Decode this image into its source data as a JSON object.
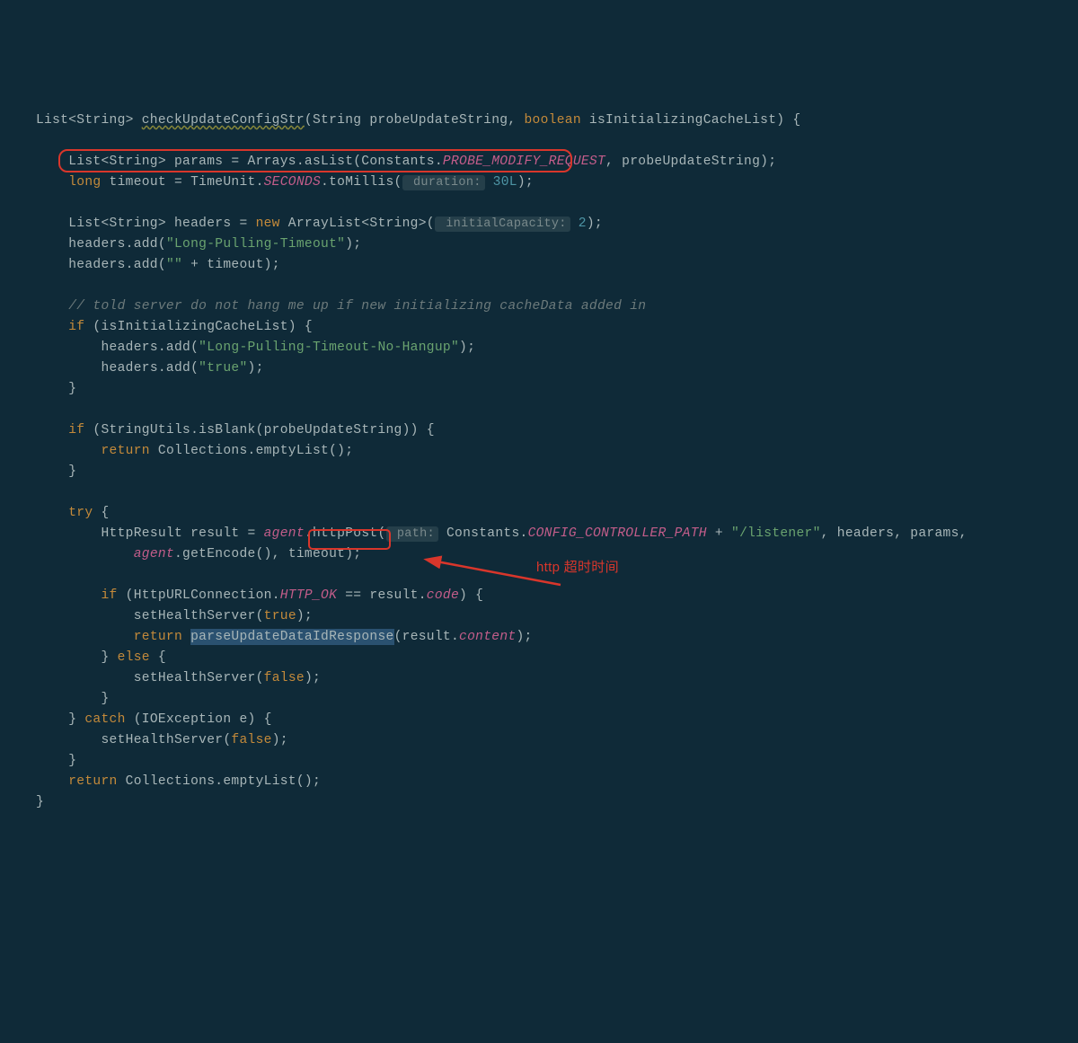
{
  "code": {
    "l1": {
      "a": "List<String> ",
      "b": "checkUpdateConfigStr",
      "c": "(String probeUpdateString, ",
      "d": "boolean",
      "e": " isInitializingCacheList) {"
    },
    "l3": {
      "a": "List<String> params = Arrays.asList(Constants.",
      "b": "PROBE_MODIFY_REQUEST",
      "c": ", probeUpdateString);"
    },
    "l4": {
      "a": "long",
      "b": " timeout = TimeUnit.",
      "c": "SECONDS",
      "d": ".toMillis(",
      "hint": " duration:",
      "e": " 30L",
      "f": ");"
    },
    "l6": {
      "a": "List<String> headers = ",
      "b": "new",
      "c": " ArrayList<String>(",
      "hint": " initialCapacity:",
      "d": " 2",
      "e": ");"
    },
    "l7": {
      "a": "headers.add(",
      "b": "\"Long-Pulling-Timeout\"",
      "c": ");"
    },
    "l8": {
      "a": "headers.add(",
      "b": "\"\"",
      "c": " + timeout);"
    },
    "l10": {
      "a": "// told server do not hang me up if new initializing cacheData added in"
    },
    "l11": {
      "a": "if",
      "b": " (isInitializingCacheList) {"
    },
    "l12": {
      "a": "headers.add(",
      "b": "\"Long-Pulling-Timeout-No-Hangup\"",
      "c": ");"
    },
    "l13": {
      "a": "headers.add(",
      "b": "\"true\"",
      "c": ");"
    },
    "l14": {
      "a": "}"
    },
    "l16": {
      "a": "if",
      "b": " (StringUtils.isBlank(probeUpdateString)) {"
    },
    "l17": {
      "a": "return",
      "b": " Collections.emptyList();"
    },
    "l18": {
      "a": "}"
    },
    "l20": {
      "a": "try",
      "b": " {"
    },
    "l21": {
      "a": "HttpResult result = ",
      "b": "agent",
      "c": ".httpPost(",
      "hint": " path:",
      "d": " Constants.",
      "e": "CONFIG_CONTROLLER_PATH",
      "f": " + ",
      "g": "\"/listener\"",
      "h": ", headers, params,"
    },
    "l22": {
      "a": "agent",
      "b": ".getEncode(), ",
      "c": "timeout",
      "d": ");"
    },
    "l24": {
      "a": "if",
      "b": " (HttpURLConnection.",
      "c": "HTTP_OK",
      "d": " == result.",
      "e": "code",
      "f": ") {"
    },
    "l25": {
      "a": "setHealthServer(",
      "b": "true",
      "c": ");"
    },
    "l26": {
      "a": "return",
      "b": " ",
      "c": "parseUpdateDataIdResponse",
      "d": "(result.",
      "e": "content",
      "f": ");"
    },
    "l27": {
      "a": "} ",
      "b": "else",
      "c": " {"
    },
    "l28": {
      "a": "setHealthServer(",
      "b": "false",
      "c": ");"
    },
    "l29": {
      "a": "}"
    },
    "l30": {
      "a": "} ",
      "b": "catch",
      "c": " (IOException e) {"
    },
    "l31": {
      "a": "setHealthServer(",
      "b": "false",
      "c": ");"
    },
    "l32": {
      "a": "}"
    },
    "l33": {
      "a": "return",
      "b": " Collections.emptyList();"
    },
    "l34": {
      "a": "}"
    }
  },
  "annotation": {
    "label": "http 超时时间"
  }
}
